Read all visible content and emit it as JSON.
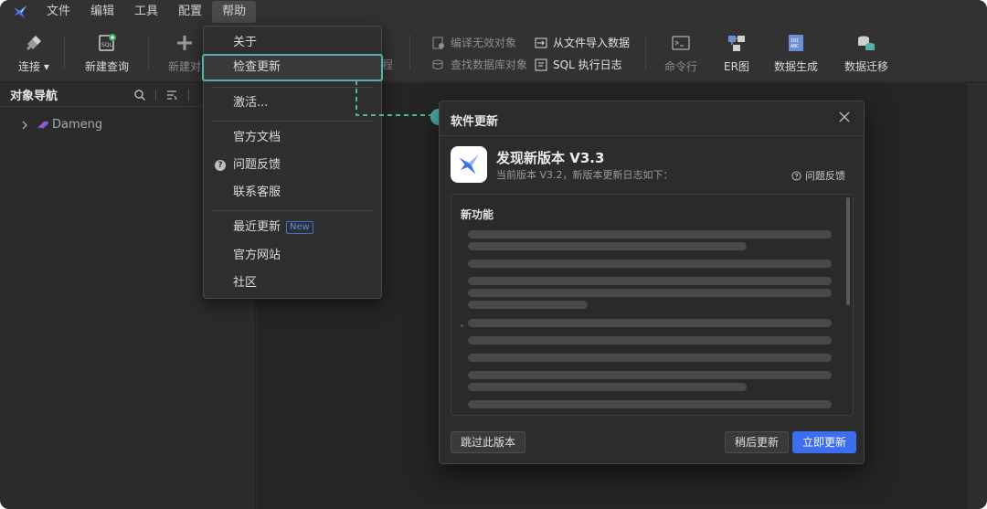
{
  "menubar": {
    "items": [
      "文件",
      "编辑",
      "工具",
      "配置",
      "帮助"
    ],
    "active_index": 4
  },
  "toolbar": {
    "connect": "连接",
    "new_query": "新建查询",
    "new_object": "新建对",
    "compile_invalid": "编译无效对象",
    "find_db_object": "查找数据库对象",
    "import_from_file": "从文件导入数据",
    "sql_log": "SQL 执行日志",
    "command_line": "命令行",
    "er_diagram": "ER图",
    "data_gen": "数据生成",
    "data_migration": "数据迁移",
    "hidden_suffix": "程"
  },
  "sidebar": {
    "title": "对象导航",
    "tree": [
      {
        "label": "Dameng"
      }
    ]
  },
  "help_menu": {
    "items": [
      {
        "label": "关于"
      },
      {
        "label": "检查更新"
      },
      {
        "label": "激活..."
      },
      {
        "label": "官方文档"
      },
      {
        "label": "问题反馈"
      },
      {
        "label": "联系客服"
      },
      {
        "label": "最近更新",
        "badge": "New"
      },
      {
        "label": "官方网站"
      },
      {
        "label": "社区"
      }
    ]
  },
  "dialog": {
    "title": "软件更新",
    "headline": "发现新版本 V3.3",
    "subtitle": "当前版本 V3.2，新版本更新日志如下：",
    "feedback": "问题反馈",
    "changelog_title": "新功能",
    "skip_button": "跳过此版本",
    "later_button": "稍后更新",
    "update_button": "立即更新"
  },
  "colors": {
    "accent_teal": "#4fb3a9",
    "primary_blue": "#3d6ef0",
    "badge_blue": "#5b8cf0",
    "window_bg": "#2b2b2b"
  },
  "icons": {
    "close": "close-icon",
    "question": "question-circle-icon",
    "connect": "plug-icon",
    "search": "search-icon"
  }
}
